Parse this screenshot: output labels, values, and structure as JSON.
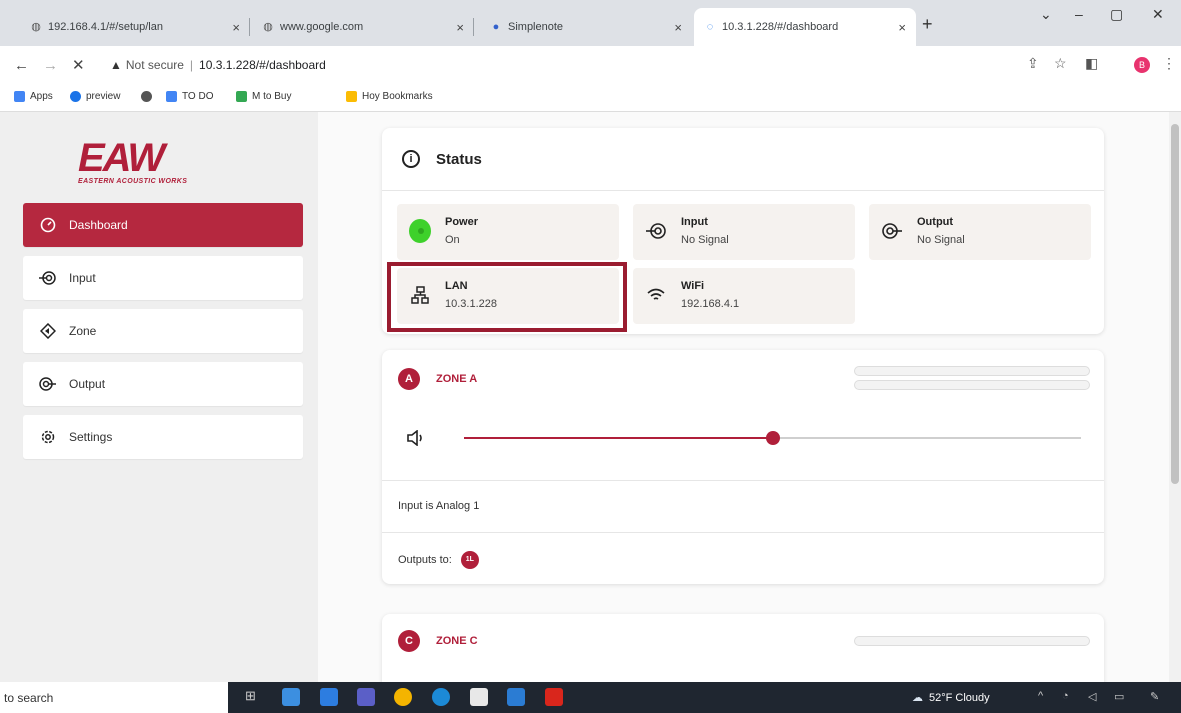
{
  "browser": {
    "tabs": [
      {
        "title": "192.168.4.1/#/setup/lan",
        "icon": "globe-icon"
      },
      {
        "title": "www.google.com",
        "icon": "globe-icon"
      },
      {
        "title": "Simplenote",
        "icon": "simplenote-icon"
      },
      {
        "title": "10.3.1.228/#/dashboard",
        "icon": "loading-icon"
      }
    ],
    "close_glyph": "×",
    "new_tab_glyph": "+",
    "address": {
      "warning": "Not secure",
      "url": "10.3.1.228/#/dashboard"
    },
    "profile_letter": "B",
    "bookmarks": [
      {
        "label": "Apps",
        "color": "#4285f4"
      },
      {
        "label": "preview",
        "color": "#1a73e8"
      },
      {
        "label": "",
        "color": "#555555"
      },
      {
        "label": "TO DO",
        "color": "#4285f4"
      },
      {
        "label": "M to Buy",
        "color": "#34a853"
      },
      {
        "label": "Hoy Bookmarks",
        "color": "#fbbc04"
      }
    ]
  },
  "app": {
    "brand": {
      "logo_text": "EAW",
      "tagline": "EASTERN ACOUSTIC WORKS",
      "color": "#b01f3a"
    },
    "nav": [
      {
        "label": "Dashboard",
        "icon": "dashboard-gauge-icon",
        "active": true
      },
      {
        "label": "Input",
        "icon": "input-icon",
        "active": false
      },
      {
        "label": "Zone",
        "icon": "zone-icon",
        "active": false
      },
      {
        "label": "Output",
        "icon": "output-icon",
        "active": false
      },
      {
        "label": "Settings",
        "icon": "settings-gear-icon",
        "active": false
      }
    ],
    "status": {
      "title": "Status",
      "tiles": [
        {
          "label": "Power",
          "value": "On",
          "icon": "power-indicator-icon"
        },
        {
          "label": "Input",
          "value": "No Signal",
          "icon": "input-icon"
        },
        {
          "label": "Output",
          "value": "No Signal",
          "icon": "output-icon"
        },
        {
          "label": "LAN",
          "value": "10.3.1.228",
          "icon": "lan-network-icon"
        },
        {
          "label": "WiFi",
          "value": "192.168.4.1",
          "icon": "wifi-icon"
        }
      ]
    },
    "zone_a": {
      "badge": "A",
      "name": "ZONE A",
      "volume_fraction": 0.5,
      "input_text": "Input is Analog 1",
      "outputs_label": "Outputs to:",
      "output_chip": "1L"
    },
    "zone_c": {
      "badge": "C",
      "name": "ZONE C"
    }
  },
  "taskbar": {
    "search_text": "to search",
    "weather": "52°F  Cloudy"
  }
}
